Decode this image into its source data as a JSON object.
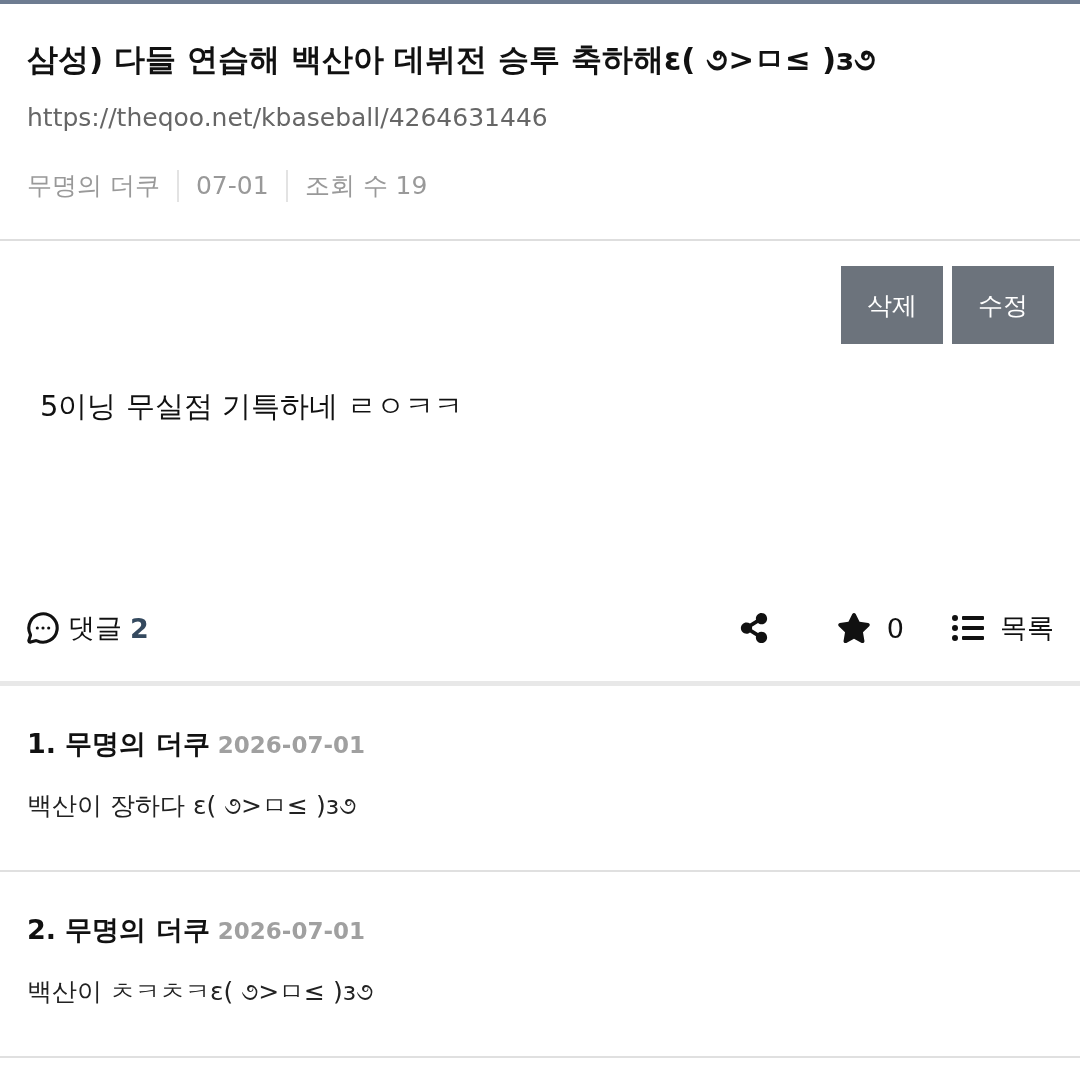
{
  "post": {
    "title": "삼성) 다들 연습해 백산아 데뷔전 승투 축하해ε( ૭>ㅁ≤ )з૭",
    "url": "https://theqoo.net/kbaseball/4264631446",
    "meta": [
      "무명의 더쿠",
      "07-01",
      "조회 수 19"
    ]
  },
  "actions": [
    {
      "label": "삭제"
    },
    {
      "label": "수정"
    }
  ],
  "body": "5이닝 무실점 기특하네 ㄹㅇㅋㅋ",
  "toolbar": {
    "comments_label": "댓글",
    "comments_count": "2",
    "star_count": "0",
    "list_label": "목록"
  },
  "comments": [
    {
      "author": "1. 무명의 더쿠",
      "date": "2026-07-01",
      "text": "백산이 장하다 ε( ૭>ㅁ≤ )з૭"
    },
    {
      "author": "2. 무명의 더쿠",
      "date": "2026-07-01",
      "text": "백산이 ㅊㅋㅊㅋε( ૭>ㅁ≤ )з૭"
    }
  ]
}
